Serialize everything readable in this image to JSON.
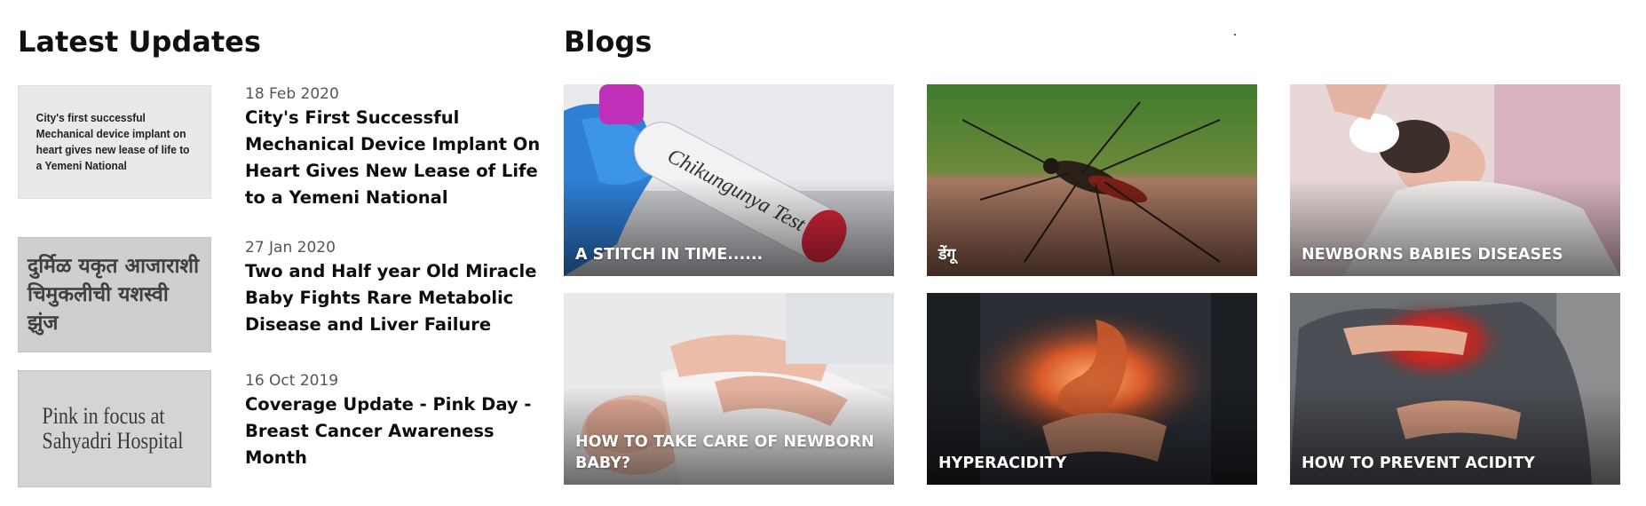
{
  "latest_updates": {
    "title": "Latest Updates",
    "items": [
      {
        "thumb_text": "City's first successful Mechanical device implant on heart gives new lease of life to a Yemeni National",
        "date": "18 Feb 2020",
        "title": "City's First Successful Mechanical Device Implant On Heart Gives New Lease of Life to a Yemeni National"
      },
      {
        "thumb_text": "दुर्मिळ यकृत आजाराशी चिमुकलीची यशस्वी झुंज",
        "date": "27 Jan 2020",
        "title": "Two and Half year Old Miracle Baby Fights Rare Metabolic Disease and Liver Failure"
      },
      {
        "thumb_text": "Pink in focus at Sahyadri Hospital",
        "date": "16 Oct 2019",
        "title": "Coverage Update - Pink Day - Breast Cancer Awareness Month"
      }
    ]
  },
  "blogs": {
    "title": "Blogs",
    "cards": [
      {
        "label": "A STITCH IN TIME......",
        "image_text": "Chikungunya Test",
        "image": "test-tube-photo"
      },
      {
        "label": "डेंगू",
        "image": "mosquito-photo"
      },
      {
        "label": "NEWBORNS BABIES DISEASES",
        "image": "newborn-photo"
      },
      {
        "label": "HOW TO TAKE CARE OF NEWBORN BABY?",
        "image": "baby-massage-photo"
      },
      {
        "label": "HYPERACIDITY",
        "image": "stomach-photo"
      },
      {
        "label": "HOW TO PREVENT ACIDITY",
        "image": "acidity-photo"
      }
    ]
  }
}
